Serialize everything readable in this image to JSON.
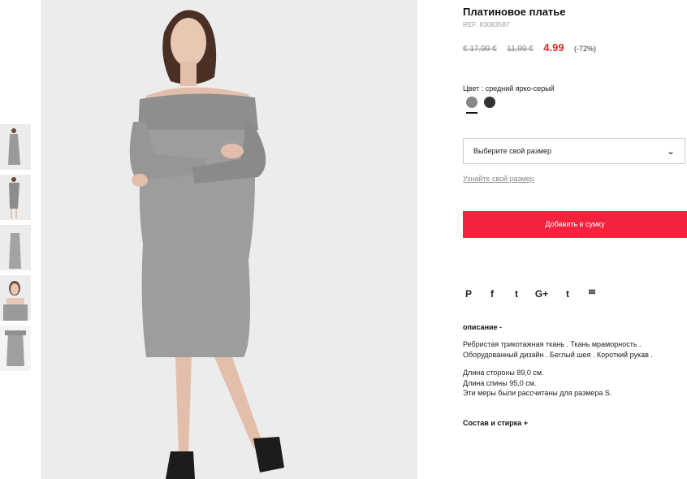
{
  "product": {
    "title": "Платиновое платье",
    "ref": "REF. 83083587",
    "price_old_1": "€ 17,99 €",
    "price_old_2": "11,99 €",
    "price_now": "4.99",
    "discount": "(-72%)"
  },
  "color": {
    "label": "Цвет :",
    "value": "средний ярко-серый",
    "swatches": [
      "#888888",
      "#333333"
    ]
  },
  "size": {
    "select_label": "Выберите свой размер",
    "guide_link": "Узнайте свой размер"
  },
  "cart": {
    "add_label": "Добавить в сумку"
  },
  "share": {
    "icons": [
      "pinterest-icon",
      "facebook-icon",
      "twitter-icon",
      "google-plus-icon",
      "tumblr-icon",
      "email-icon"
    ],
    "glyphs": [
      "P",
      "f",
      "t",
      "G+",
      "t",
      "✉"
    ]
  },
  "description": {
    "heading": "описание -",
    "line1": "Ребристая трикотажная ткань . Ткань мраморность .",
    "line2": "Оборудованный дизайн . Беглый шея . Короткий рукав .",
    "m1": "Длина стороны 89,0 см.",
    "m2": "Длина спины 95,0 см.",
    "m3": "Эти меры были рассчитаны для размера S."
  },
  "composition": {
    "heading": "Состав и стирка +"
  },
  "colors": {
    "accent": "#f5223d",
    "price": "#e4262f"
  }
}
